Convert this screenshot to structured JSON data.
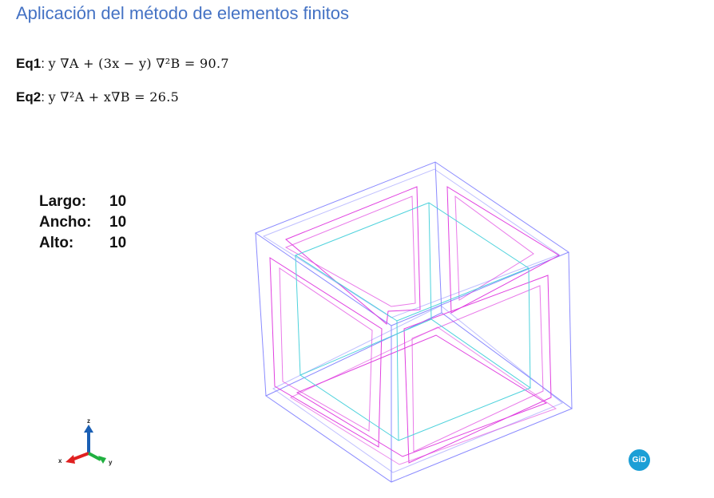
{
  "title": "Aplicación del método de elementos finitos",
  "equations": {
    "eq1": {
      "label": "Eq1",
      "sep": ":",
      "expr": "y ∇A + (3x − y) ∇²B = 90.7"
    },
    "eq2": {
      "label": "Eq2",
      "sep": ":",
      "expr": "y ∇²A + x∇B = 26.5"
    }
  },
  "dimensions": [
    {
      "key": "Largo:",
      "value": "10"
    },
    {
      "key": "Ancho:",
      "value": "10"
    },
    {
      "key": "Alto:",
      "value": "10"
    }
  ],
  "axes": {
    "x": "x",
    "y": "y",
    "z": "z"
  },
  "logo": {
    "text": "GiD"
  },
  "colors": {
    "title": "#4472c4",
    "outer_box": "#8080ff",
    "magenta_frames": "#e040e0",
    "inner_box": "#40d0d8",
    "axis_x": "#e02020",
    "axis_y": "#20b040",
    "axis_z": "#1a5fb4",
    "logo": "#1c9fd6"
  }
}
